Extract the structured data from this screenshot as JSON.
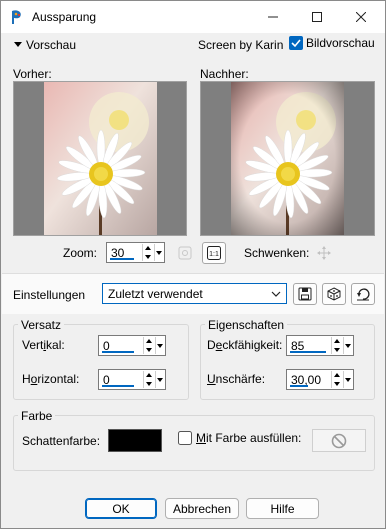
{
  "window": {
    "title": "Aussparung",
    "minimize_icon": "minimize-icon",
    "maximize_icon": "maximize-icon",
    "close_icon": "close-icon"
  },
  "preview_header": {
    "toggle_label": "Vorschau",
    "credit": "Screen by Karin",
    "checkbox_label": "Bildvorschau",
    "checkbox_checked": true
  },
  "previews": {
    "before_label": "Vorher:",
    "after_label": "Nachher:"
  },
  "zoom": {
    "label": "Zoom:",
    "value": "30",
    "pan_label": "Schwenken:"
  },
  "settings": {
    "label": "Einstellungen",
    "selected": "Zuletzt verwendet"
  },
  "versatz": {
    "title": "Versatz",
    "vertical_label": "Vertikal:",
    "vertical_value": "0",
    "horizontal_label": "Horizontal:",
    "horizontal_value": "0"
  },
  "eigenschaften": {
    "title": "Eigenschaften",
    "opacity_label": "Deckfähigkeit:",
    "opacity_value": "85",
    "blur_label": "Unschärfe:",
    "blur_value": "30,00"
  },
  "farbe": {
    "title": "Farbe",
    "shadow_label": "Schattenfarbe:",
    "shadow_color": "#000000",
    "fill_label": "Mit Farbe ausfüllen:",
    "fill_checked": false
  },
  "buttons": {
    "ok": "OK",
    "cancel": "Abbrechen",
    "help": "Hilfe"
  },
  "colors": {
    "accent": "#0067c0"
  }
}
